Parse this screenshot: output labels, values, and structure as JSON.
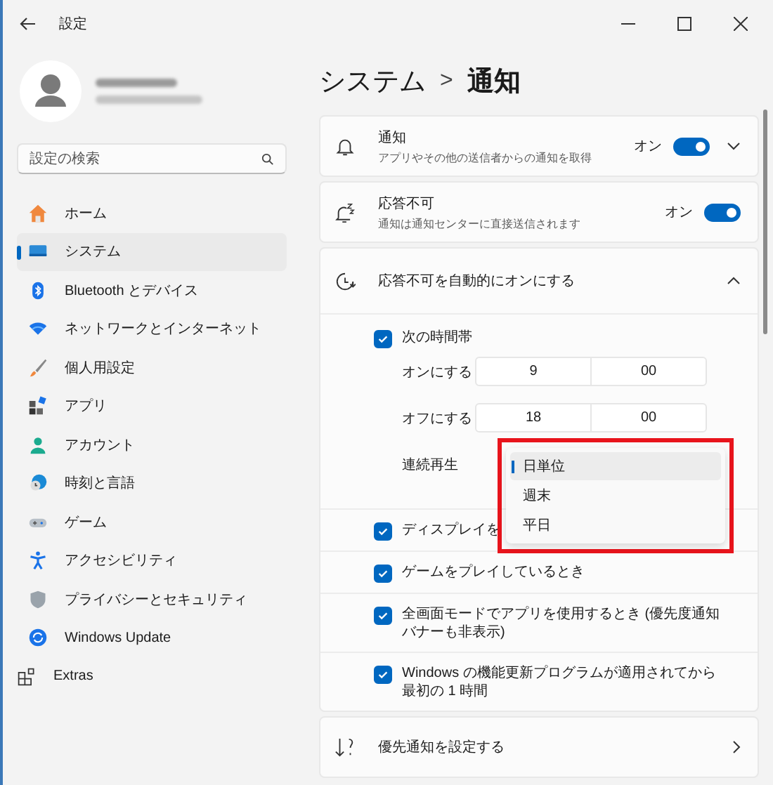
{
  "window": {
    "title": "設定"
  },
  "sidebar": {
    "search": {
      "placeholder": "設定の検索"
    },
    "items": [
      {
        "label": "ホーム",
        "selected": false
      },
      {
        "label": "システム",
        "selected": true
      },
      {
        "label": "Bluetooth とデバイス",
        "selected": false
      },
      {
        "label": "ネットワークとインターネット",
        "selected": false
      },
      {
        "label": "個人用設定",
        "selected": false
      },
      {
        "label": "アプリ",
        "selected": false
      },
      {
        "label": "アカウント",
        "selected": false
      },
      {
        "label": "時刻と言語",
        "selected": false
      },
      {
        "label": "ゲーム",
        "selected": false
      },
      {
        "label": "アクセシビリティ",
        "selected": false
      },
      {
        "label": "プライバシーとセキュリティ",
        "selected": false
      },
      {
        "label": "Windows Update",
        "selected": false
      },
      {
        "label": "Extras",
        "selected": false
      }
    ]
  },
  "breadcrumb": {
    "parent": "システム",
    "separator": ">",
    "current": "通知"
  },
  "notifications": {
    "title": "通知",
    "subtitle": "アプリやその他の送信者からの通知を取得",
    "state_label": "オン",
    "on": true
  },
  "do_not_disturb": {
    "title": "応答不可",
    "subtitle": "通知は通知センターに直接送信されます",
    "state_label": "オン",
    "on": true
  },
  "auto_dnd": {
    "title": "応答不可を自動的にオンにする",
    "expanded": true,
    "schedule": {
      "label": "次の時間帯",
      "checked": true,
      "turn_on": {
        "label": "オンにする",
        "hour": "9",
        "minute": "00"
      },
      "turn_off": {
        "label": "オフにする",
        "hour": "18",
        "minute": "00"
      },
      "repeat": {
        "label": "連続再生",
        "options": [
          {
            "label": "日単位",
            "selected": true
          },
          {
            "label": "週末",
            "selected": false
          },
          {
            "label": "平日",
            "selected": false
          }
        ]
      }
    },
    "conditions": [
      {
        "label": "ディスプレイを",
        "checked": true
      },
      {
        "label": "ゲームをプレイしているとき",
        "checked": true
      },
      {
        "label": "全画面モードでアプリを使用するとき (優先度通知バナーも非表示)",
        "checked": true
      },
      {
        "label": "Windows の機能更新プログラムが適用されてから最初の 1 時間",
        "checked": true
      }
    ]
  },
  "priority": {
    "title": "優先通知を設定する"
  }
}
